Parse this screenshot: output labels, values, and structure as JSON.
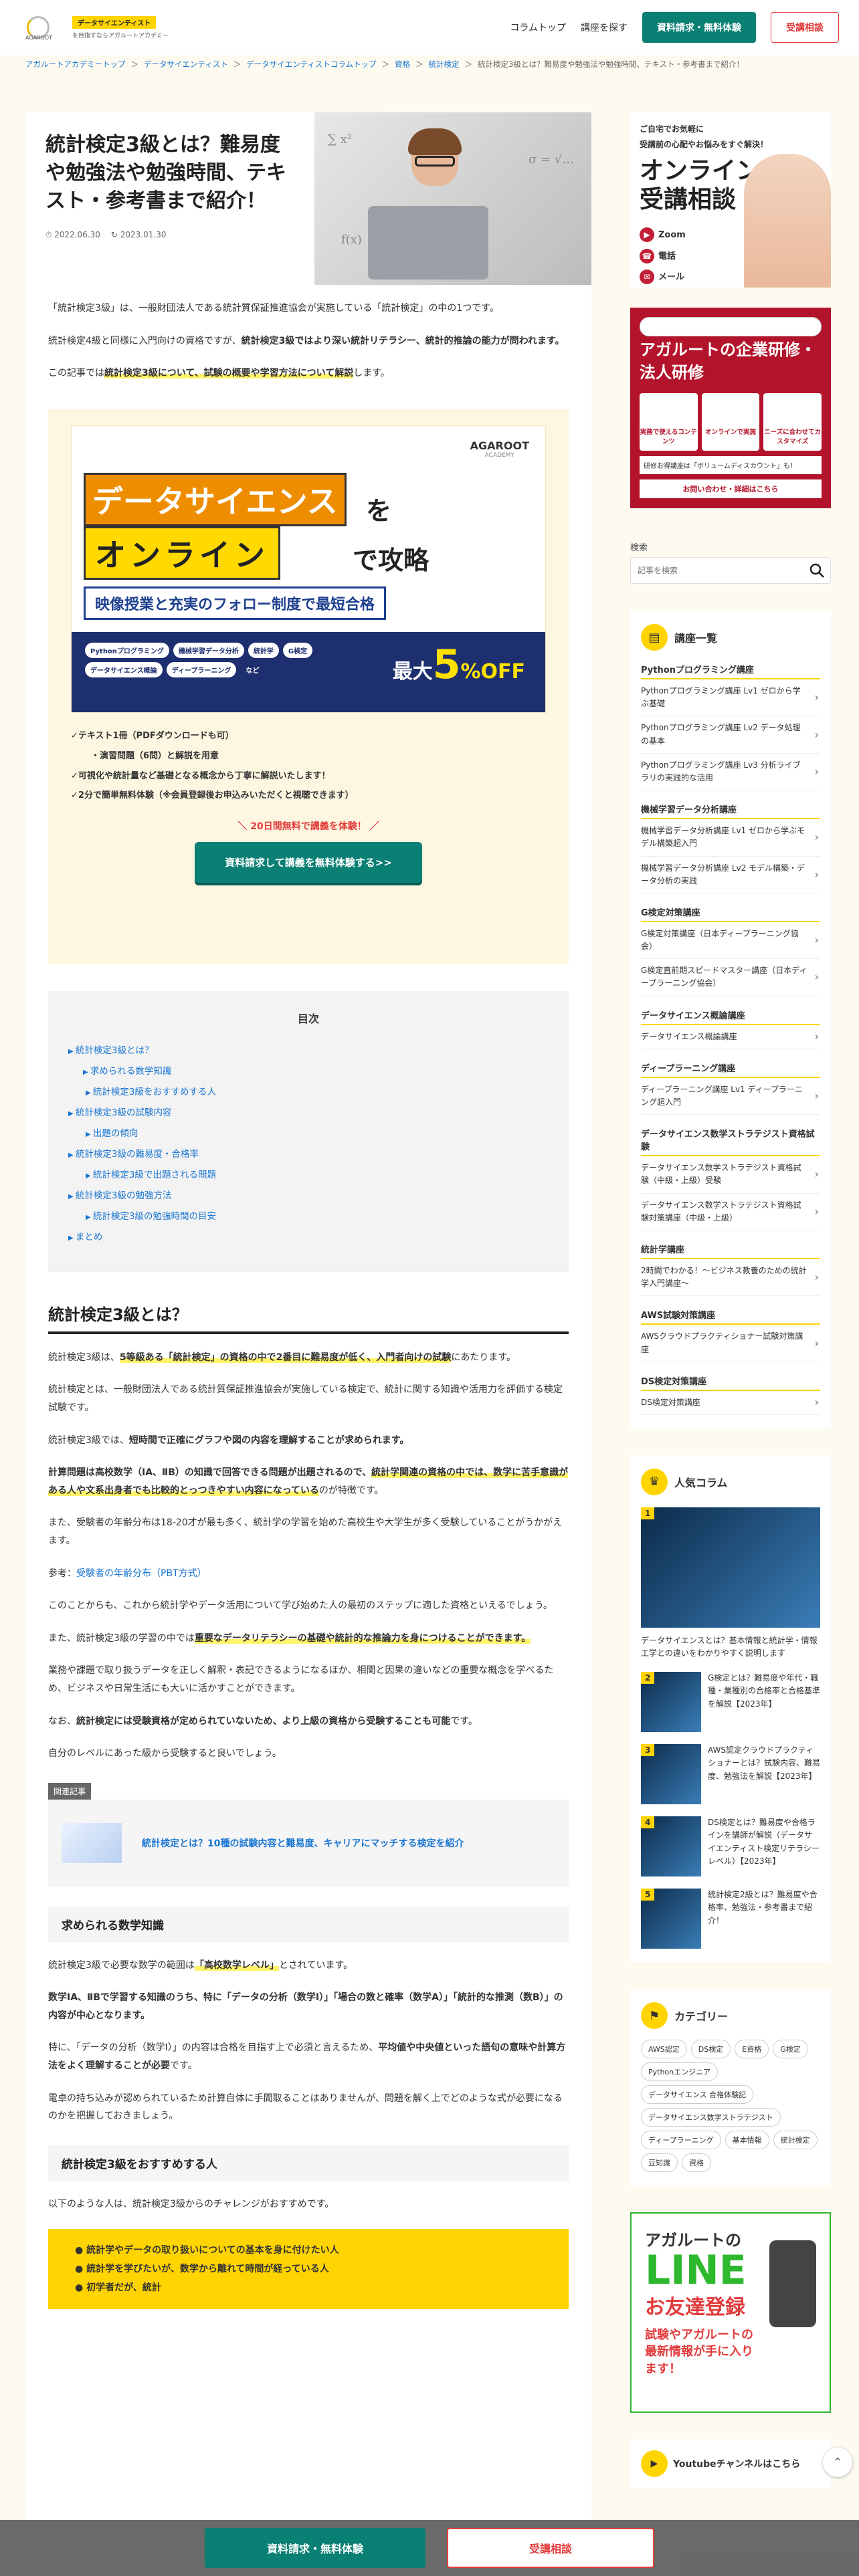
{
  "header": {
    "logo_line1": "データサイエンティスト",
    "logo_line2": "を目指すならアガルートアカデミー",
    "logo_mark": "AGAROOT",
    "nav_column_top": "コラムトップ",
    "nav_find_course": "講座を探す",
    "btn_request": "資料請求・無料体験",
    "btn_consult": "受講相談"
  },
  "breadcrumb": [
    "アガルートアカデミートップ",
    "データサイエンティスト",
    "データサイエンティストコラムトップ",
    "資格",
    "統計検定",
    "統計検定3級とは？難易度や勉強法や勉強時間、テキスト・参考書まで紹介！"
  ],
  "article": {
    "title": "統計検定3級とは？難易度や勉強法や勉強時間、テキスト・参考書まで紹介！",
    "published": "2022.06.30",
    "updated": "2023.01.30",
    "intro1": "「統計検定3級」は、一般財団法人である統計質保証推進協会が実施している「統計検定」の中の1つです。",
    "intro2_a": "統計検定4級と同様に入門向けの資格ですが、",
    "intro2_b": "統計検定3級ではより深い統計リテラシー、統計的推論の能力が問われます。",
    "intro3_a": "この記事では",
    "intro3_hl": "統計検定3級について、試験の概要や学習方法について解説",
    "intro3_b": "します。"
  },
  "ad": {
    "logo": "AGAROOT",
    "logo_sub": "ACADEMY",
    "t1": "データサイエンス",
    "t1b": "を",
    "t2": "オンライン",
    "t2b": "で攻略",
    "t3": "映像授業と充実のフォロー制度で最短合格",
    "chips": [
      "Pythonプログラミング",
      "機械学習データ分析",
      "統計学",
      "G検定",
      "データサイエンス概論",
      "ディープラーニング",
      "など"
    ],
    "off_prefix": "最大",
    "off_num": "5",
    "off_suffix": "%OFF",
    "list": [
      "テキスト1冊（PDFダウンロードも可）",
      "・演習問題（6問）と解説を用意",
      "可視化や統計量など基礎となる概念から丁寧に解説いたします！",
      "2分で簡単無料体験（※会員登録後お申込みいただくと視聴できます）"
    ],
    "free": "＼ 20日間無料で講義を体験！ ／",
    "button": "資料請求して講義を無料体験する>>"
  },
  "toc": {
    "title": "目次",
    "items": [
      {
        "label": "統計検定3級とは？",
        "level": 1
      },
      {
        "label": "求められる数学知識",
        "level": 2
      },
      {
        "label": "統計検定3級をおすすめする人",
        "level": 3
      },
      {
        "label": "統計検定3級の試験内容",
        "level": 1
      },
      {
        "label": "出題の傾向",
        "level": 3
      },
      {
        "label": "統計検定3級の難易度・合格率",
        "level": 1
      },
      {
        "label": "統計検定3級で出題される問題",
        "level": 3
      },
      {
        "label": "統計検定3級の勉強方法",
        "level": 1
      },
      {
        "label": "統計検定3級の勉強時間の目安",
        "level": 3
      },
      {
        "label": "まとめ",
        "level": 1
      }
    ]
  },
  "section1": {
    "heading": "統計検定3級とは？",
    "p1_a": "統計検定3級は、",
    "p1_hl": "5等級ある「統計検定」の資格の中で2番目に難易度が低く、入門者向けの試験",
    "p1_b": "にあたります。",
    "p2": "統計検定とは、一般財団法人である統計質保証推進協会が実施している検定で、統計に関する知識や活用力を評価する検定試験です。",
    "p3_a": "統計検定3級では、",
    "p3_b": "短時間で正確にグラフや図の内容を理解することが求められます。",
    "p4_a": "計算問題は高校数学（ⅠA、ⅡB）の知識で回答できる問題が出題されるので、",
    "p4_hl": "統計学関連の資格の中では、数学に苦手意識がある人や文系出身者でも比較的とっつきやすい内容になっている",
    "p4_b": "のが特徴です。",
    "p5": "また、受験者の年齢分布は18-20才が最も多く、統計学の学習を始めた高校生や大学生が多く受験していることがうかがえます。",
    "p6_a": "参考：",
    "p6_link": "受験者の年齢分布（PBT方式）",
    "p7": "このことからも、これから統計学やデータ活用について学び始めた人の最初のステップに適した資格といえるでしょう。",
    "p8_a": "また、統計検定3級の学習の中では",
    "p8_hl": "重要なデータリテラシーの基礎や統計的な推論力を身につけることができます。",
    "p9": "業務や課題で取り扱うデータを正しく解釈・表記できるようになるほか、相関と因果の違いなどの重要な概念を学べるため、ビジネスや日常生活にも大いに活かすことができます。",
    "p10_a": "なお、",
    "p10_b": "統計検定には受験資格が定められていないため、より上級の資格から受験することも可能",
    "p10_c": "です。",
    "p11": "自分のレベルにあった級から受験すると良いでしょう。",
    "related_label": "関連記事",
    "related_link": "統計検定とは？10種の試験内容と難易度、キャリアにマッチする検定を紹介"
  },
  "section2": {
    "heading": "求められる数学知識",
    "p1_a": "統計検定3級で必要な数学の範囲は",
    "p1_hl": "「高校数学レベル」",
    "p1_b": "とされています。",
    "p2": "数学ⅠA、ⅡBで学習する知識のうち、特に「データの分析（数学Ⅰ）」「場合の数と確率（数学A）」「統計的な推測（数B）」の内容が中心となります。",
    "p3_a": "特に、「データの分析（数学Ⅰ）」の内容は合格を目指す上で必須と言えるため、",
    "p3_b": "平均値や中央値といった語句の意味や計算方法をよく理解することが必要",
    "p3_c": "です。",
    "p4": "電卓の持ち込みが認められているため計算自体に手間取ることはありませんが、問題を解く上でどのような式が必要になるのかを把握しておきましょう。"
  },
  "section3": {
    "heading": "統計検定3級をおすすめする人",
    "p1": "以下のような人は、統計検定3級からのチャレンジがおすすめです。",
    "list": [
      "統計学やデータの取り扱いについての基本を身に付けたい人",
      "統計学を学びたいが、数学から離れて時間が経っている人",
      "初学者だが、統計"
    ]
  },
  "sidebar": {
    "promo1": {
      "s1": "ご自宅でお気軽に",
      "s2": "受講前の心配やお悩みをすぐ解決！",
      "big": "オンライン受講相談",
      "m1": "Zoom",
      "m2": "電話",
      "m3": "メール"
    },
    "promo2": {
      "tag": "法人向け",
      "big": "アガルートの企業研修・法人研修",
      "c1": "実務で使えるコンテンツ",
      "c2": "オンラインで実施",
      "c3": "ニーズに合わせてカスタマイズ",
      "note": "研修お得講座は「ボリュームディスカウント」も！",
      "cta": "お問い合わせ・詳細はこちら"
    },
    "search_label": "検索",
    "search_placeholder": "記事を検索",
    "courses_title": "講座一覧",
    "courses": [
      {
        "group": "Pythonプログラミング講座",
        "items": [
          "Pythonプログラミング講座 Lv1 ゼロから学ぶ基礎",
          "Pythonプログラミング講座 Lv2 データ処理の基本",
          "Pythonプログラミング講座 Lv3 分析ライブラリの実践的な活用"
        ]
      },
      {
        "group": "機械学習データ分析講座",
        "items": [
          "機械学習データ分析講座 Lv1 ゼロから学ぶモデル構築超入門",
          "機械学習データ分析講座 Lv2 モデル構築・データ分析の実践"
        ]
      },
      {
        "group": "G検定対策講座",
        "items": [
          "G検定対策講座（日本ディープラーニング協会）",
          "G検定直前期スピードマスター講座（日本ディープラーニング協会）"
        ]
      },
      {
        "group": "データサイエンス概論講座",
        "items": [
          "データサイエンス概論講座"
        ]
      },
      {
        "group": "ディープラーニング講座",
        "items": [
          "ディープラーニング講座 Lv1 ディープラーニング超入門"
        ]
      },
      {
        "group": "データサイエンス数学ストラテジスト資格試験",
        "items": [
          "データサイエンス数学ストラテジスト資格試験（中級・上級）受験",
          "データサイエンス数学ストラテジスト資格試験対策講座（中級・上級）"
        ]
      },
      {
        "group": "統計学講座",
        "items": [
          "2時間でわかる！〜ビジネス教養のための統計学入門講座〜"
        ]
      },
      {
        "group": "AWS試験対策講座",
        "items": [
          "AWSクラウドプラクティショナー試験対策講座"
        ]
      },
      {
        "group": "DS検定対策講座",
        "items": [
          "DS検定対策講座"
        ]
      }
    ],
    "popular_title": "人気コラム",
    "popular": [
      {
        "n": "1",
        "t": "データサイエンスとは？基本情報と統計学・情報工学との違いをわかりやすく説明します"
      },
      {
        "n": "2",
        "t": "G検定とは？難易度や年代・職種・業種別の合格率と合格基準を解説【2023年】"
      },
      {
        "n": "3",
        "t": "AWS認定クラウドプラクティショナーとは？試験内容、難易度、勉強法を解説【2023年】"
      },
      {
        "n": "4",
        "t": "DS検定とは？難易度や合格ラインを講師が解説（データサイエンティスト検定リテラシーレベル）【2023年】"
      },
      {
        "n": "5",
        "t": "統計検定2級とは？難易度や合格率、勉強法・参考書まで紹介！"
      }
    ],
    "category_title": "カテゴリー",
    "categories": [
      "AWS認定",
      "DS検定",
      "E資格",
      "G検定",
      "Pythonエンジニア",
      "データサイエンス 合格体験記",
      "データサイエンス数学ストラテジスト",
      "ディープラーニング",
      "基本情報",
      "統計検定",
      "豆知識",
      "資格"
    ],
    "line": {
      "a1": "アガルートの",
      "a2": "LINE",
      "a3": "お友達登録",
      "a4": "試験やアガルートの最新情報が手に入ります！"
    },
    "youtube": "Youtubeチャンネルはこちら"
  },
  "bottombar": {
    "request": "資料請求・無料体験",
    "consult": "受講相談"
  }
}
